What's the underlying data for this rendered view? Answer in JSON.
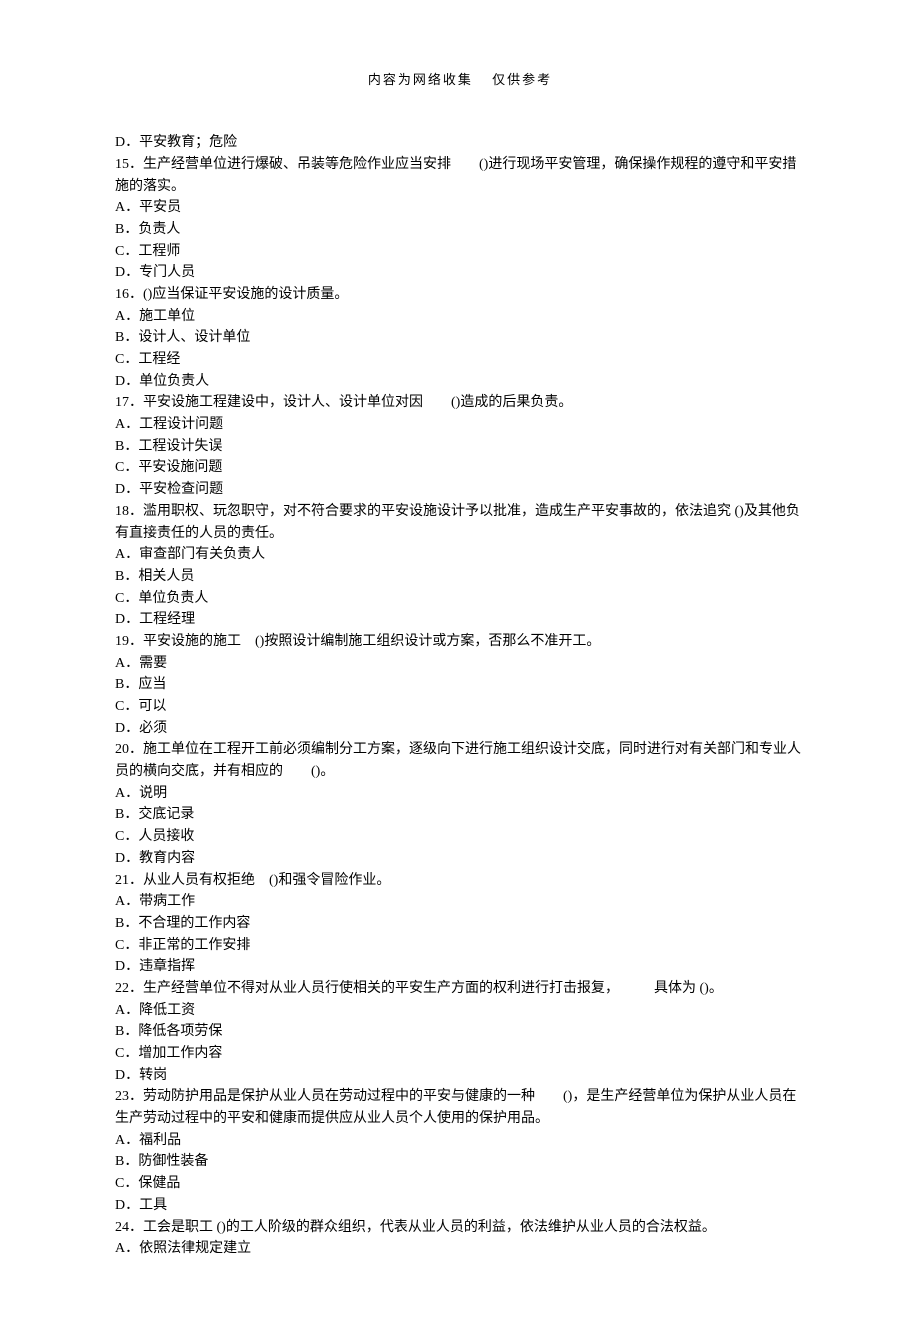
{
  "header": "内容为网络收集 仅供参考",
  "items": [
    {
      "text": "D．平安教育；危险"
    },
    {
      "text": "15．生产经营单位进行爆破、吊装等危险作业应当安排　　()进行现场平安管理，确保操作规程的遵守和平安措施的落实。"
    },
    {
      "text": "A．平安员"
    },
    {
      "text": "B．负责人"
    },
    {
      "text": "C．工程师"
    },
    {
      "text": "D．专门人员"
    },
    {
      "text": "16．()应当保证平安设施的设计质量。"
    },
    {
      "text": "A．施工单位"
    },
    {
      "text": "B．设计人、设计单位"
    },
    {
      "text": "C．工程经"
    },
    {
      "text": "D．单位负责人"
    },
    {
      "text": "17．平安设施工程建设中，设计人、设计单位对因　　()造成的后果负责。"
    },
    {
      "text": "A．工程设计问题"
    },
    {
      "text": "B．工程设计失误"
    },
    {
      "text": "C．平安设施问题"
    },
    {
      "text": "D．平安检查问题"
    },
    {
      "text": "18．滥用职权、玩忽职守，对不符合要求的平安设施设计予以批准，造成生产平安事故的，依法追究 ()及其他负有直接责任的人员的责任。"
    },
    {
      "text": "A．审查部门有关负责人"
    },
    {
      "text": "B．相关人员"
    },
    {
      "text": "C．单位负责人"
    },
    {
      "text": "D．工程经理"
    },
    {
      "text": "19．平安设施的施工 ()按照设计编制施工组织设计或方案，否那么不准开工。"
    },
    {
      "text": "A．需要"
    },
    {
      "text": "B．应当"
    },
    {
      "text": "C．可以"
    },
    {
      "text": "D．必须"
    },
    {
      "text": "20．施工单位在工程开工前必须编制分工方案，逐级向下进行施工组织设计交底，同时进行对有关部门和专业人员的横向交底，并有相应的　　()。"
    },
    {
      "text": "A．说明"
    },
    {
      "text": "B．交底记录"
    },
    {
      "text": "C．人员接收"
    },
    {
      "text": "D．教育内容"
    },
    {
      "text": "21．从业人员有权拒绝 ()和强令冒险作业。"
    },
    {
      "text": "A．带病工作"
    },
    {
      "text": "B．不合理的工作内容"
    },
    {
      "text": "C．非正常的工作安排"
    },
    {
      "text": "D．违章指挥"
    },
    {
      "text": "22．生产经营单位不得对从业人员行使相关的平安生产方面的权利进行打击报复，　　　具体为 ()。"
    },
    {
      "text": "A．降低工资"
    },
    {
      "text": "B．降低各项劳保"
    },
    {
      "text": "C．增加工作内容"
    },
    {
      "text": "D．转岗"
    },
    {
      "text": "23．劳动防护用品是保护从业人员在劳动过程中的平安与健康的一种　　()，是生产经营单位为保护从业人员在生产劳动过程中的平安和健康而提供应从业人员个人使用的保护用品。"
    },
    {
      "text": "A．福利品"
    },
    {
      "text": "B．防御性装备"
    },
    {
      "text": "C．保健品"
    },
    {
      "text": "D．工具"
    },
    {
      "text": "24．工会是职工 ()的工人阶级的群众组织，代表从业人员的利益，依法维护从业人员的合法权益。"
    },
    {
      "text": "A．依照法律规定建立"
    }
  ]
}
